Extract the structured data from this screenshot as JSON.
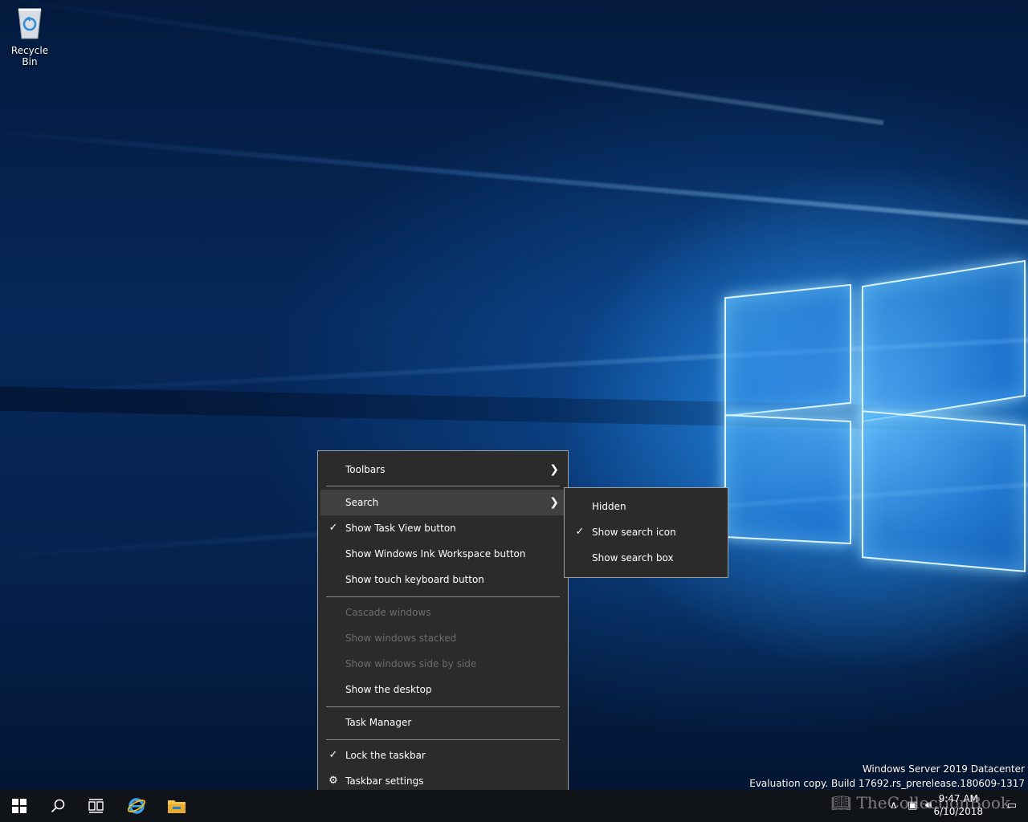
{
  "desktop": {
    "icons": [
      {
        "label": "Recycle Bin",
        "icon": "recycle-bin-icon"
      }
    ]
  },
  "context_menu": {
    "items": [
      {
        "label": "Toolbars",
        "submenu": true,
        "checked": false,
        "enabled": true
      },
      {
        "label": "Search",
        "submenu": true,
        "checked": false,
        "enabled": true,
        "highlighted": true
      },
      {
        "label": "Show Task View button",
        "checked": true,
        "enabled": true
      },
      {
        "label": "Show Windows Ink Workspace button",
        "checked": false,
        "enabled": true
      },
      {
        "label": "Show touch keyboard button",
        "checked": false,
        "enabled": true
      },
      {
        "label": "Cascade windows",
        "checked": false,
        "enabled": false
      },
      {
        "label": "Show windows stacked",
        "checked": false,
        "enabled": false
      },
      {
        "label": "Show windows side by side",
        "checked": false,
        "enabled": false
      },
      {
        "label": "Show the desktop",
        "checked": false,
        "enabled": true
      },
      {
        "label": "Task Manager",
        "checked": false,
        "enabled": true
      },
      {
        "label": "Lock the taskbar",
        "checked": true,
        "enabled": true
      },
      {
        "label": "Taskbar settings",
        "icon": "gear-icon",
        "checked": false,
        "enabled": true
      }
    ]
  },
  "search_submenu": {
    "items": [
      {
        "label": "Hidden",
        "checked": false
      },
      {
        "label": "Show search icon",
        "checked": true
      },
      {
        "label": "Show search box",
        "checked": false
      }
    ]
  },
  "watermark": {
    "line1": "Windows Server 2019 Datacenter",
    "line2": "Evaluation copy. Build 17692.rs_prerelease.180609-1317"
  },
  "taskbar": {
    "buttons": [
      "start-icon",
      "search-icon",
      "task-view-icon",
      "internet-explorer-icon",
      "file-explorer-icon"
    ],
    "clock": {
      "time": "9:47 AM",
      "date": "6/10/2018"
    },
    "overlay_text": "TheCollectionBook"
  },
  "colors": {
    "menu_bg": "#2b2b2b",
    "menu_highlight": "#414141",
    "menu_disabled_text": "#6d6d6d",
    "taskbar_bg": "#101318",
    "desktop_blue": "#0a3d7a"
  }
}
